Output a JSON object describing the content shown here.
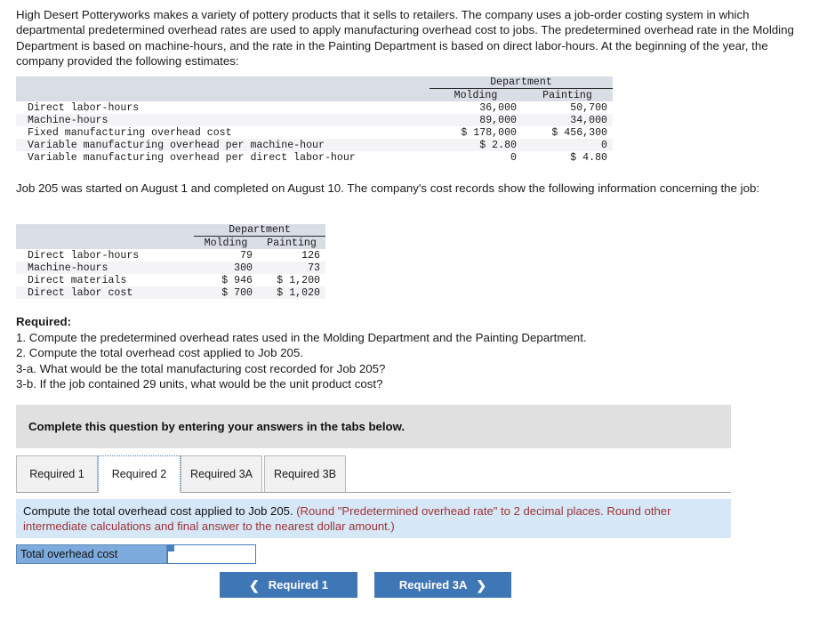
{
  "intro": {
    "paragraph": "High Desert Potteryworks makes a variety of pottery products that it sells to retailers. The company uses a job-order costing system in which departmental predetermined overhead rates are used to apply manufacturing overhead cost to jobs. The predetermined overhead rate in the Molding Department is based on machine-hours, and the rate in the Painting Department is based on direct labor-hours. At the beginning of the year, the company provided the following estimates:"
  },
  "estimates_table": {
    "group_header": "Department",
    "columns": [
      "Molding",
      "Painting"
    ],
    "rows": [
      {
        "label": "Direct labor-hours",
        "molding": "36,000",
        "painting": "50,700"
      },
      {
        "label": "Machine-hours",
        "molding": "89,000",
        "painting": "34,000"
      },
      {
        "label": "Fixed manufacturing overhead cost",
        "molding": "$ 178,000",
        "painting": "$ 456,300"
      },
      {
        "label": "Variable manufacturing overhead per machine-hour",
        "molding": "$ 2.80",
        "painting": "0"
      },
      {
        "label": "Variable manufacturing overhead per direct labor-hour",
        "molding": "0",
        "painting": "$ 4.80"
      }
    ]
  },
  "job_intro": {
    "paragraph": "Job 205 was started on August 1 and completed on August 10. The company's cost records show the following information concerning the job:"
  },
  "job_table": {
    "group_header": "Department",
    "columns": [
      "Molding",
      "Painting"
    ],
    "rows": [
      {
        "label": "Direct labor-hours",
        "molding": "79",
        "painting": "126"
      },
      {
        "label": "Machine-hours",
        "molding": "300",
        "painting": "73"
      },
      {
        "label": "Direct materials",
        "molding": "$ 946",
        "painting": "$ 1,200"
      },
      {
        "label": "Direct labor cost",
        "molding": "$ 700",
        "painting": "$ 1,020"
      }
    ]
  },
  "required": {
    "title": "Required:",
    "items": [
      "1. Compute the predetermined overhead rates used in the Molding Department and the Painting Department.",
      "2. Compute the total overhead cost applied to Job 205.",
      "3-a. What would be the total manufacturing cost recorded for Job 205?",
      "3-b. If the job contained 29 units, what would be the unit product cost?"
    ]
  },
  "banner": {
    "text": "Complete this question by entering your answers in the tabs below."
  },
  "tabs": [
    {
      "label": "Required 1",
      "active": false
    },
    {
      "label": "Required 2",
      "active": true
    },
    {
      "label": "Required 3A",
      "active": false
    },
    {
      "label": "Required 3B",
      "active": false
    }
  ],
  "question_panel": {
    "main_text": "Compute the total overhead cost applied to Job 205.",
    "rounding_text": "(Round \"Predetermined overhead rate\" to 2 decimal places. Round other intermediate calculations and final answer to the nearest dollar amount.)"
  },
  "answer": {
    "label": "Total overhead cost",
    "value": "",
    "placeholder": ""
  },
  "navigation": {
    "prev_label": "Required 1",
    "next_label": "Required 3A",
    "prev_icon": "chevron-left",
    "next_icon": "chevron-right"
  },
  "colors": {
    "accent_blue": "#3f76b5",
    "panel_blue": "#d6e7f7",
    "label_cell_blue": "#7dabdd",
    "banner_gray": "#e0e0e0",
    "table_header_gray": "#d9dde5",
    "rounding_red": "#9e3434"
  }
}
